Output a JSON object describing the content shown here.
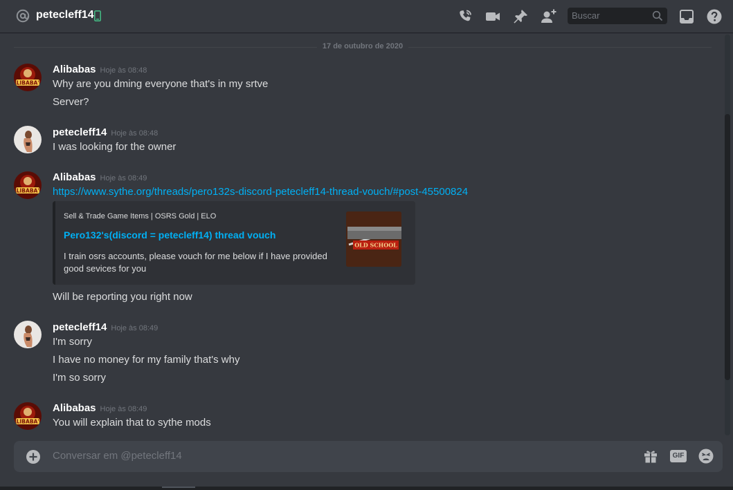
{
  "header": {
    "title": "petecleff14",
    "search_placeholder": "Buscar",
    "icons": [
      "at-icon",
      "mobile-icon",
      "phone-call-icon",
      "video-call-icon",
      "pin-icon",
      "add-friend-icon",
      "search-icon",
      "inbox-icon",
      "help-icon"
    ]
  },
  "date_divider": "17 de outubro de 2020",
  "messages": [
    {
      "author": "Alibabas",
      "timestamp": "Hoje às 08:48",
      "lines": [
        "Why are you dming everyone that's in my srtve",
        "Server?"
      ]
    },
    {
      "author": "petecleff14",
      "timestamp": "Hoje às 08:48",
      "lines": [
        "I was looking for the owner"
      ]
    },
    {
      "author": "Alibabas",
      "timestamp": "Hoje às 08:49",
      "link": "https://www.sythe.org/threads/pero132s-discord-petecleff14-thread-vouch/#post-45500824",
      "embed": {
        "provider": "Sell & Trade Game Items | OSRS Gold | ELO",
        "title": "Pero132's(discord = petecleff14) thread vouch",
        "description": "I train osrs accounts, please vouch for me below if I have provided good sevices for you"
      },
      "after": "Will be reporting you right now"
    },
    {
      "author": "petecleff14",
      "timestamp": "Hoje às 08:49",
      "lines": [
        "I'm sorry",
        "I have no money for my family that's why",
        "I'm so sorry"
      ]
    },
    {
      "author": "Alibabas",
      "timestamp": "Hoje às 08:49",
      "lines": [
        "You will explain that to sythe mods"
      ]
    }
  ],
  "avatar_labels": {
    "alibabas": "ALIBABA'S",
    "thumbnail": "OLD SCHOOL"
  },
  "composer": {
    "placeholder": "Conversar em @petecleff14",
    "gif_label": "GIF"
  },
  "colors": {
    "background": "#36393f",
    "link": "#00b0f4",
    "timestamp": "#72767d",
    "embed_bg": "#2f3136",
    "input_bg": "#40444b",
    "mobile_status": "#43b581"
  }
}
